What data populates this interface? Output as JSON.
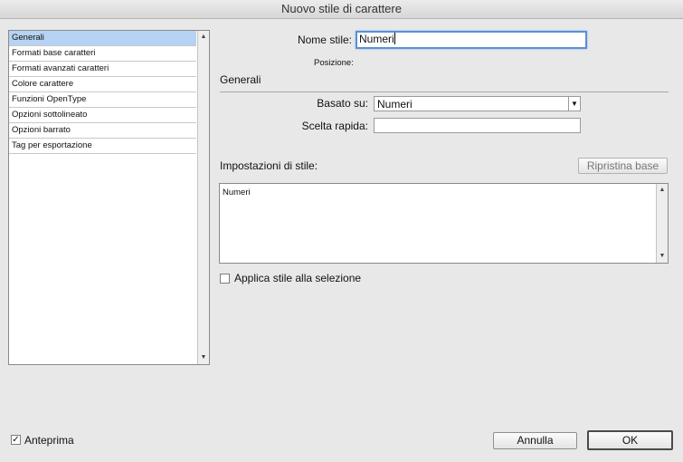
{
  "window": {
    "title": "Nuovo stile di carattere"
  },
  "sidebar": {
    "items": [
      {
        "label": "Generali",
        "selected": true
      },
      {
        "label": "Formati base caratteri"
      },
      {
        "label": "Formati avanzati caratteri"
      },
      {
        "label": "Colore carattere"
      },
      {
        "label": "Funzioni OpenType"
      },
      {
        "label": "Opzioni sottolineato"
      },
      {
        "label": "Opzioni barrato"
      },
      {
        "label": "Tag per esportazione"
      }
    ]
  },
  "form": {
    "style_name_label": "Nome stile:",
    "style_name_value": "Numeri",
    "position_label": "Posizione:",
    "section_title": "Generali",
    "based_on_label": "Basato su:",
    "based_on_value": "Numeri",
    "shortcut_label": "Scelta rapida:",
    "shortcut_value": "",
    "style_settings_label": "Impostazioni di stile:",
    "reset_button_label": "Ripristina base",
    "style_settings_text": "Numeri",
    "apply_label": "Applica stile alla selezione",
    "apply_checked": false
  },
  "footer": {
    "preview_label": "Anteprima",
    "preview_checked": true,
    "cancel_label": "Annulla",
    "ok_label": "OK"
  },
  "colors": {
    "selection": "#b7d3f3",
    "focus_ring": "#5b8fd5",
    "dialog_bg": "#e8e8e8"
  }
}
